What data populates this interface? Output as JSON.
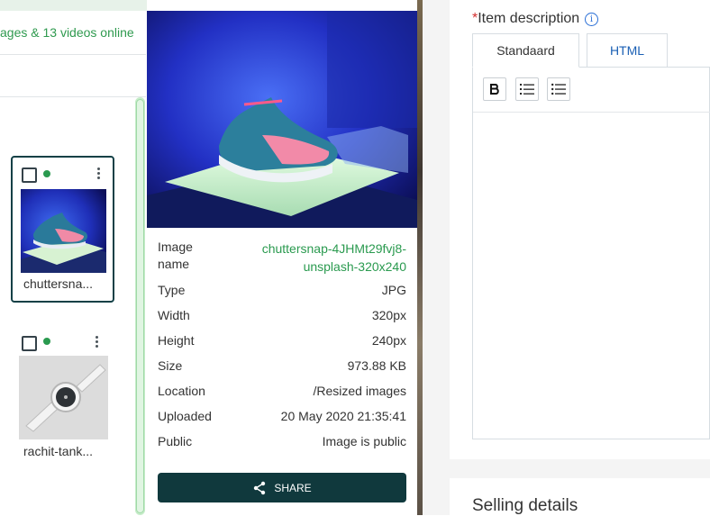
{
  "media_panel": {
    "status_text": "ages & 13 videos online",
    "cards": [
      {
        "name": "chuttersna..."
      },
      {
        "name": "rachit-tank..."
      }
    ]
  },
  "details": {
    "rows": [
      {
        "key": "Image",
        "key2": "name",
        "value": "chuttersnap-4JHMt29fvj8-",
        "value2": "unsplash-320x240"
      },
      {
        "key": "Type",
        "value": "JPG"
      },
      {
        "key": "Width",
        "value": "320px"
      },
      {
        "key": "Height",
        "value": "240px"
      },
      {
        "key": "Size",
        "value": "973.88 KB"
      },
      {
        "key": "Location",
        "value": "/Resized images"
      },
      {
        "key": "Uploaded",
        "value": "20 May 2020 21:35:41"
      },
      {
        "key": "Public",
        "value": "Image is public"
      }
    ],
    "share_label": "SHARE"
  },
  "form": {
    "required_mark": "*",
    "description_label": "Item description",
    "info_icon_glyph": "i",
    "tabs": [
      {
        "label": "Standaard"
      },
      {
        "label": "HTML"
      }
    ],
    "selling_title": "Selling details"
  },
  "colors": {
    "accent_green": "#2a9a4f",
    "share_button": "#10393d",
    "link_blue": "#1a5fb4"
  }
}
